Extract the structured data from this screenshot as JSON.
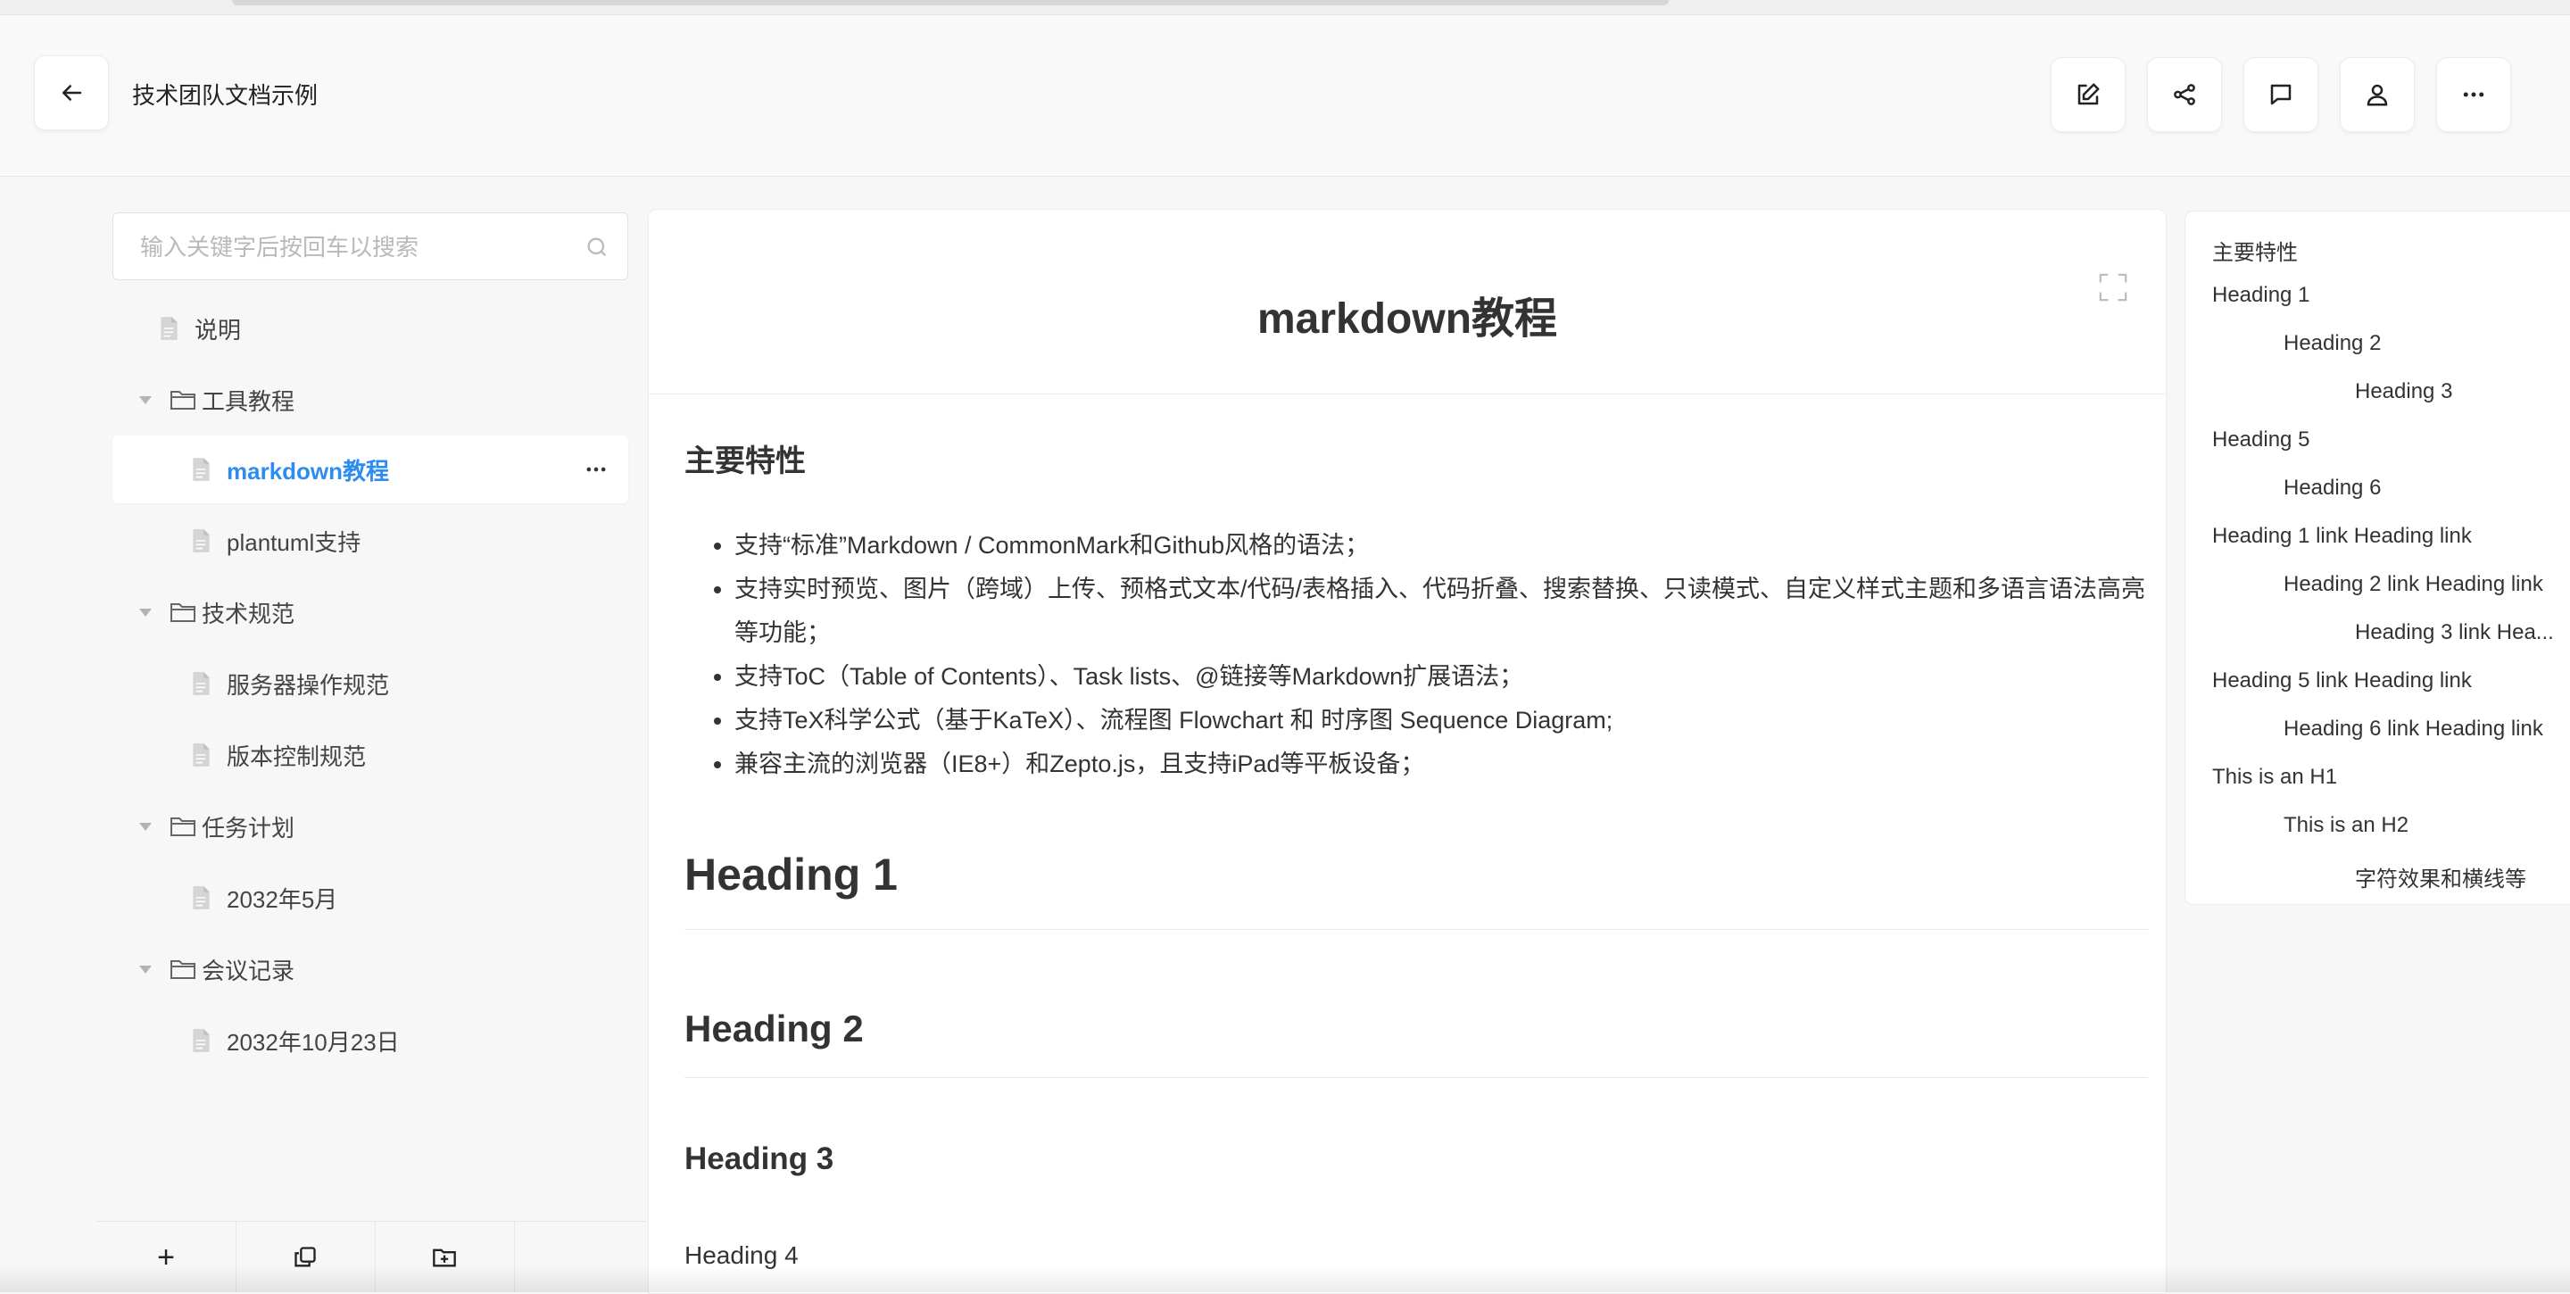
{
  "header": {
    "title": "技术团队文档示例",
    "toolbar": [
      {
        "name": "edit-button",
        "icon": "edit-icon"
      },
      {
        "name": "share-button",
        "icon": "share-icon"
      },
      {
        "name": "comment-button",
        "icon": "comment-icon"
      },
      {
        "name": "user-button",
        "icon": "user-icon"
      },
      {
        "name": "more-button",
        "icon": "more-icon"
      }
    ]
  },
  "sidebar": {
    "search_placeholder": "输入关键字后按回车以搜索",
    "items": [
      {
        "label": "说明",
        "type": "file"
      },
      {
        "label": "工具教程",
        "type": "folder"
      },
      {
        "label": "markdown教程",
        "type": "file",
        "active": true
      },
      {
        "label": "plantuml支持",
        "type": "file"
      },
      {
        "label": "技术规范",
        "type": "folder"
      },
      {
        "label": "服务器操作规范",
        "type": "file"
      },
      {
        "label": "版本控制规范",
        "type": "file"
      },
      {
        "label": "任务计划",
        "type": "folder"
      },
      {
        "label": "2032年5月",
        "type": "file"
      },
      {
        "label": "会议记录",
        "type": "folder"
      },
      {
        "label": "2032年10月23日",
        "type": "file"
      }
    ],
    "bottom_buttons": [
      "add-icon",
      "copy-icon",
      "new-folder-icon"
    ],
    "add_label": "+"
  },
  "main": {
    "title": "markdown教程",
    "section_title": "主要特性",
    "features": [
      "支持“标准”Markdown / CommonMark和Github风格的语法；",
      "支持实时预览、图片（跨域）上传、预格式文本/代码/表格插入、代码折叠、搜索替换、只读模式、自定义样式主题和多语言语法高亮等功能；",
      "支持ToC（Table of Contents）、Task lists、@链接等Markdown扩展语法；",
      "支持TeX科学公式（基于KaTeX）、流程图 Flowchart 和 时序图 Sequence Diagram;",
      "兼容主流的浏览器（IE8+）和Zepto.js，且支持iPad等平板设备；"
    ],
    "h1": "Heading 1",
    "h2": "Heading 2",
    "h3": "Heading 3",
    "h4": "Heading 4"
  },
  "toc": [
    "主要特性",
    "Heading 1",
    "Heading 2",
    "Heading 3",
    "Heading 5",
    "Heading 6",
    "Heading 1 link Heading link",
    "Heading 2 link Heading link",
    "Heading 3 link Hea...",
    "Heading 5 link Heading link",
    "Heading 6 link Heading link",
    "This is an H1",
    "This is an H2",
    "字符效果和横线等"
  ],
  "colors": {
    "accent": "#2d8cf0",
    "background": "#f7f7f7",
    "panel": "#ffffff"
  }
}
